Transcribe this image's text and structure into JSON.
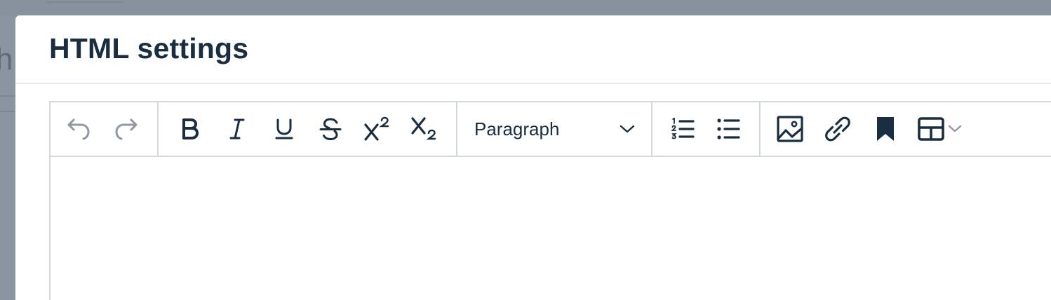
{
  "modal": {
    "title": "HTML settings"
  },
  "background": {
    "partial_letter": "h"
  },
  "toolbar": {
    "history": [
      {
        "icon": "undo-icon",
        "enabled": false
      },
      {
        "icon": "redo-icon",
        "enabled": false
      }
    ],
    "format": [
      {
        "icon": "bold-icon"
      },
      {
        "icon": "italic-icon"
      },
      {
        "icon": "underline-icon"
      },
      {
        "icon": "strikethrough-icon"
      },
      {
        "icon": "superscript-icon"
      },
      {
        "icon": "subscript-icon"
      }
    ],
    "block_type": {
      "selected": "Paragraph",
      "icon": "chevron-down-icon"
    },
    "lists": [
      {
        "icon": "ordered-list-icon"
      },
      {
        "icon": "bullet-list-icon"
      }
    ],
    "insert": [
      {
        "icon": "image-icon"
      },
      {
        "icon": "link-icon"
      },
      {
        "icon": "bookmark-icon"
      },
      {
        "icon": "table-icon"
      }
    ]
  },
  "colors": {
    "backdrop": "#87929d",
    "title": "#1b2d40",
    "icon": "#1b2d40",
    "icon_disabled": "#8f99a3",
    "border": "#d3d8dd"
  }
}
